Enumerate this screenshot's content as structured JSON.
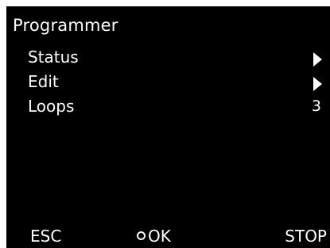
{
  "header": {
    "title": "Programmer"
  },
  "menu": {
    "items": [
      {
        "label": "Status",
        "icon": "chevron-right-icon"
      },
      {
        "label": "Edit",
        "icon": "chevron-right-icon"
      },
      {
        "label": "Loops",
        "value": "3"
      }
    ]
  },
  "softkeys": {
    "esc": "ESC",
    "ok": "OK",
    "ok_icon": "ring-icon",
    "stop": "STOP"
  },
  "colors": {
    "background": "#000000",
    "text": "#ffffff",
    "bezel": "#ffffff"
  }
}
